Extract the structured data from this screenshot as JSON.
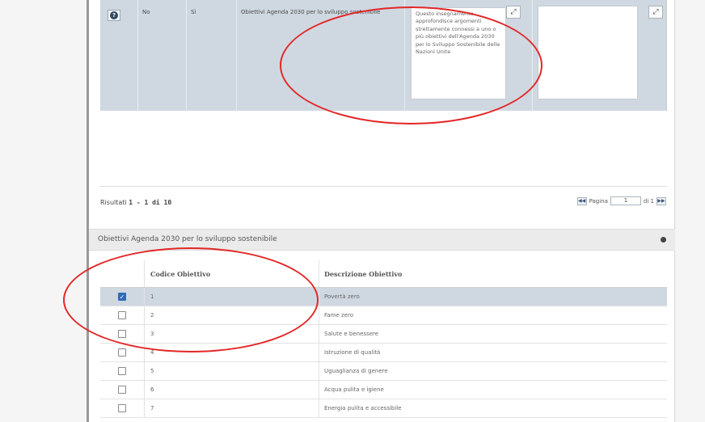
{
  "top_grid": {
    "row": {
      "col_no": "No",
      "col_si": "Sì",
      "obiettivi_label": "Obiettivi Agenda 2030 per lo sviluppo sostenibile",
      "description": "Questo insegnamento approfondisce argomenti strettamente connessi a uno o più obiettivi dell'Agenda 2030 per lo Sviluppo Sostenibile delle Nazioni Unite",
      "second_text": ""
    }
  },
  "results": {
    "prefix": "Risultati ",
    "range": "1 - 1 di 10"
  },
  "pager": {
    "label": "Pagina",
    "value": "1",
    "total": "di 1"
  },
  "section": {
    "title": "Obiettivi Agenda 2030 per lo sviluppo sostenibile"
  },
  "table": {
    "headers": [
      "",
      "Codice Obiettivo",
      "Descrizione Obiettivo"
    ],
    "rows": [
      {
        "code": "1",
        "desc": "Povertà zero",
        "checked": true
      },
      {
        "code": "2",
        "desc": "Fame zero",
        "checked": false
      },
      {
        "code": "3",
        "desc": "Salute e benessere",
        "checked": false
      },
      {
        "code": "4",
        "desc": "Istruzione di qualità",
        "checked": false
      },
      {
        "code": "5",
        "desc": "Uguaglianza di genere",
        "checked": false
      },
      {
        "code": "6",
        "desc": "Acqua pulita e igiene",
        "checked": false
      },
      {
        "code": "7",
        "desc": "Energia pulita e accessibile",
        "checked": false
      }
    ]
  },
  "icons": {
    "info": "info-icon",
    "expand": "expand-icon",
    "pager_first": "first-page-icon",
    "pager_last": "last-page-icon",
    "collapse": "collapse-icon",
    "checkbox": "checkbox-icon"
  },
  "colors": {
    "selected_row": "#cfd8e1",
    "checkbox_checked": "#2f6bb3",
    "annotation": "#e32626"
  }
}
